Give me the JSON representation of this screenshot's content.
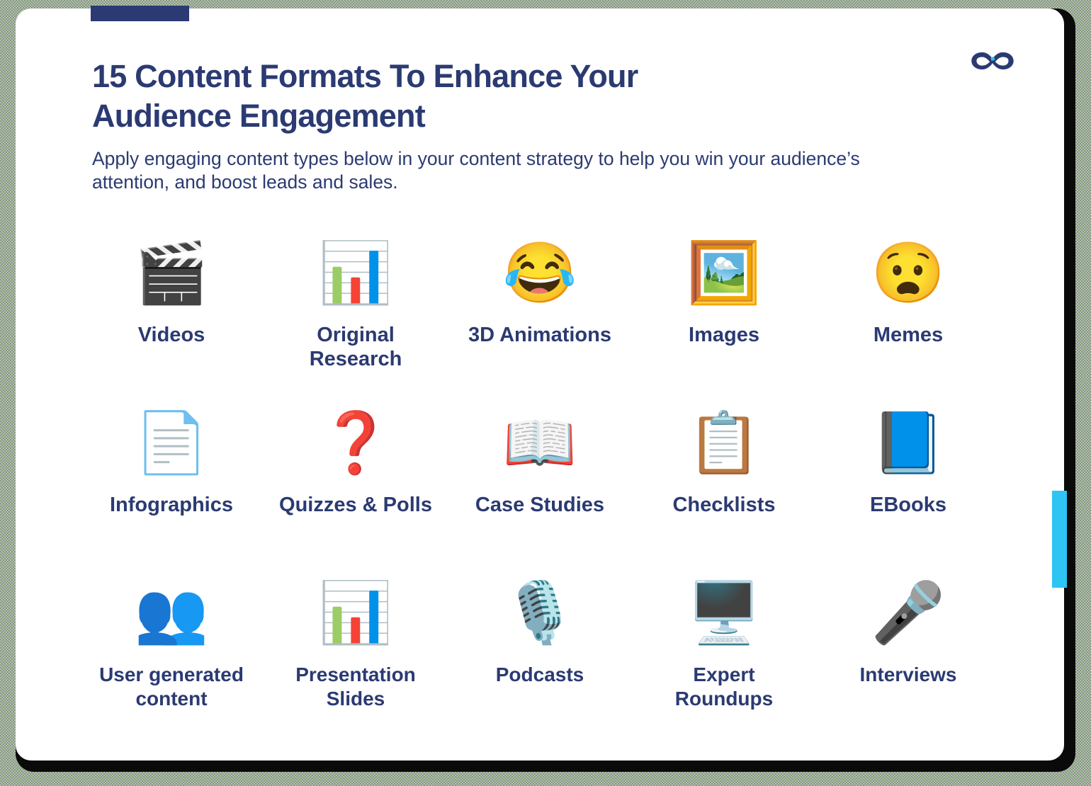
{
  "page": {
    "title": "15 Content Formats To Enhance Your Audience Engagement",
    "subtitle": "Apply engaging content types below in your content strategy to help you win your audience’s attention, and boost leads and sales.",
    "logo_icon": "infinity-logo-icon"
  },
  "colors": {
    "navy": "#2b3a72",
    "cyan_accent": "#2ec4f3",
    "card_background": "#ffffff",
    "logo_dark": "#2b3a72",
    "logo_accent": "#2ec4f3"
  },
  "decorations": {
    "top_tab": "top-navy-tab",
    "right_bar": "right-cyan-accent-bar"
  },
  "grid": {
    "columns": 5,
    "rows": 3,
    "items": [
      {
        "label": "Videos",
        "icon": "video-film-icon",
        "glyph": "🎬"
      },
      {
        "label": "Original Research",
        "icon": "bar-chart-icon",
        "glyph": "📊"
      },
      {
        "label": "3D Animations",
        "icon": "face-with-tears-of-joy-icon",
        "glyph": "😂"
      },
      {
        "label": "Images",
        "icon": "picture-image-icon",
        "glyph": "🖼️"
      },
      {
        "label": "Memes",
        "icon": "anguished-face-meme-icon",
        "glyph": "😧"
      },
      {
        "label": "Infographics",
        "icon": "document-page-icon",
        "glyph": "📄"
      },
      {
        "label": "Quizzes & Polls",
        "icon": "question-speech-bubble-icon",
        "glyph": "❓"
      },
      {
        "label": "Case Studies",
        "icon": "person-reading-book-icon",
        "glyph": "📖"
      },
      {
        "label": "Checklists",
        "icon": "clipboard-checklist-icon",
        "glyph": "📋"
      },
      {
        "label": "EBooks",
        "icon": "closed-book-icon",
        "glyph": "📘"
      },
      {
        "label": "User generated content",
        "icon": "group-of-people-icon",
        "glyph": "👥"
      },
      {
        "label": "Presentation Slides",
        "icon": "presentation-board-icon",
        "glyph": "📊"
      },
      {
        "label": "Podcasts",
        "icon": "studio-microphone-icon",
        "glyph": "🎙️"
      },
      {
        "label": "Expert Roundups",
        "icon": "person-on-monitor-icon",
        "glyph": "🖥️"
      },
      {
        "label": "Interviews",
        "icon": "microphone-stand-icon",
        "glyph": "🎤"
      }
    ]
  }
}
